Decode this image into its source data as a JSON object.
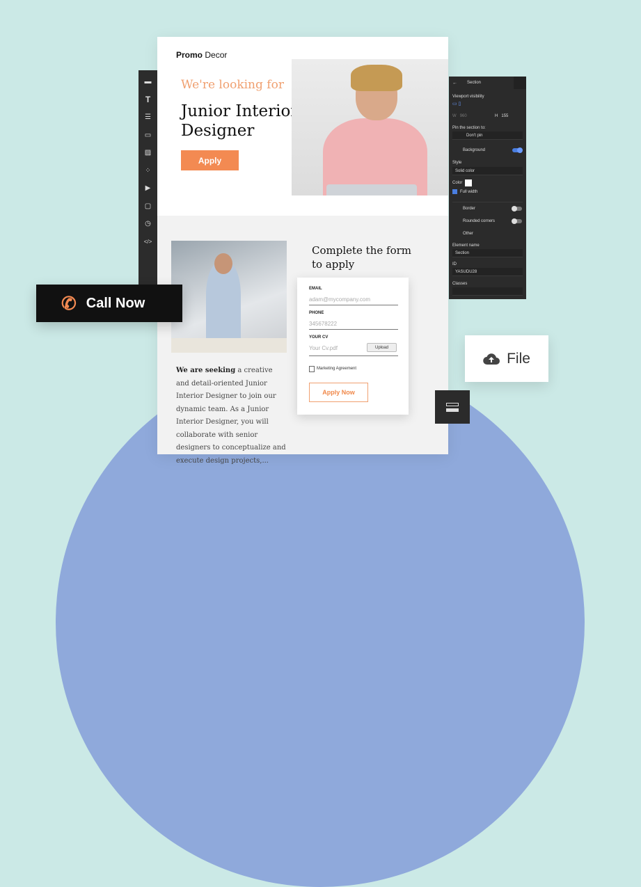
{
  "brand": {
    "logo_bold": "Promo",
    "logo_rest": " Decor"
  },
  "hero": {
    "kicker": "We're looking for",
    "title": "Junior Interior Designer",
    "apply_label": "Apply"
  },
  "description": {
    "bold": "We are seeking",
    "rest": " a creative and detail-oriented Junior Interior Designer to join our dynamic team. As a Junior Interior Designer, you will collaborate with senior designers to conceptualize and execute design projects,..."
  },
  "form": {
    "title": "Complete the form to apply",
    "email_label": "EMAIL",
    "email_placeholder": "adam@mycompany.com",
    "phone_label": "PHONE",
    "phone_placeholder": "345678222",
    "cv_label": "YOUR CV",
    "cv_placeholder": "Your Cv.pdf",
    "upload_label": "Upload",
    "checkbox_label": "Marketing Agreement",
    "submit_label": "Apply Now"
  },
  "panel": {
    "title": "Section",
    "viewport_label": "Viewport visibility",
    "w_label": "W",
    "w_value": "960",
    "h_label": "H",
    "h_value": "155",
    "pin_label": "Pin the section to:",
    "pin_value": "Don't pin",
    "background_label": "Background",
    "background_on": true,
    "style_label": "Style",
    "style_value": "Solid color",
    "color_label": "Color",
    "color_value": "#ffffff",
    "full_width_label": "Full width",
    "full_width_checked": true,
    "border_label": "Border",
    "rounded_label": "Rounded corners",
    "other_label": "Other",
    "element_name_label": "Element name",
    "element_name_value": "Section",
    "id_label": "ID",
    "id_value": "YASUDU28",
    "classes_label": "Classes"
  },
  "toolbar": {
    "icons": [
      "section-icon",
      "text-icon",
      "strip-icon",
      "button-icon",
      "image-icon",
      "widgets-icon",
      "video-icon",
      "shape-icon",
      "timer-icon",
      "code-icon"
    ]
  },
  "callouts": {
    "call_now": "Call Now",
    "file": "File"
  },
  "colors": {
    "accent": "#f38a52",
    "background": "#cbe9e6",
    "circle": "#8fa9db",
    "panel": "#2b2b2b",
    "toggle_on": "#4a7ee0"
  }
}
